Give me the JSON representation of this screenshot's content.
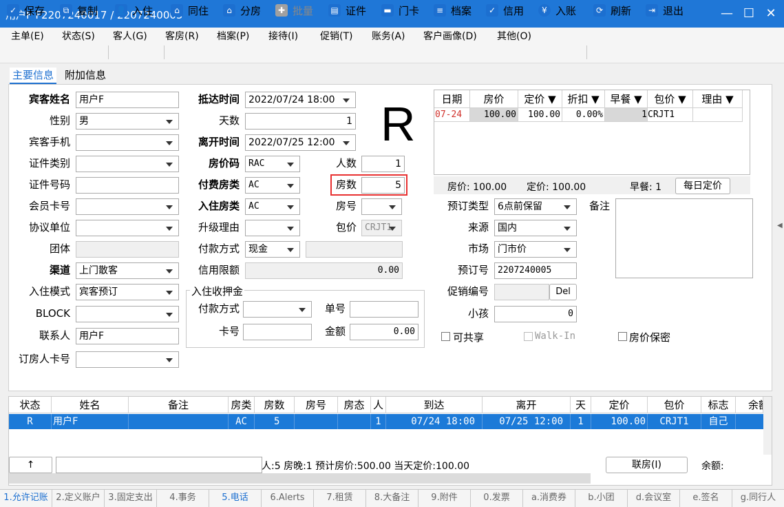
{
  "window": {
    "title": "用户F  F2207240017 / 2207240005",
    "min": "—",
    "max": "☐",
    "close": "✕"
  },
  "menu": [
    "主单(E)",
    "状态(S)",
    "客人(G)",
    "客房(R)",
    "档案(P)",
    "接待(I)",
    "促销(T)",
    "账务(A)",
    "客户画像(D)",
    "其他(O)"
  ],
  "toolbar": [
    {
      "label": "保存",
      "icon": "save-icon",
      "glyph": "✓"
    },
    {
      "label": "复制",
      "icon": "copy-icon",
      "glyph": "⧉"
    },
    {
      "label": "入住",
      "icon": "checkin-icon",
      "glyph": "👤"
    },
    {
      "label": "同住",
      "icon": "share-room-icon",
      "glyph": "⌂"
    },
    {
      "label": "分房",
      "icon": "assign-room-icon",
      "glyph": "⌂"
    },
    {
      "label": "批量",
      "icon": "batch-icon",
      "glyph": "✚"
    },
    {
      "label": "证件",
      "icon": "id-card-icon",
      "glyph": "▤"
    },
    {
      "label": "门卡",
      "icon": "door-card-icon",
      "glyph": "▬"
    },
    {
      "label": "档案",
      "icon": "profile-icon",
      "glyph": "≡"
    },
    {
      "label": "信用",
      "icon": "credit-icon",
      "glyph": "✓"
    },
    {
      "label": "入账",
      "icon": "post-charge-icon",
      "glyph": "¥"
    },
    {
      "label": "刷新",
      "icon": "refresh-icon",
      "glyph": "⟳"
    },
    {
      "label": "退出",
      "icon": "exit-icon",
      "glyph": "⇥"
    }
  ],
  "tabs": {
    "main": "主要信息",
    "extra": "附加信息"
  },
  "form": {
    "guest_name_label": "宾客姓名",
    "guest_name": "用户F",
    "gender_label": "性别",
    "gender": "男",
    "mobile_label": "宾客手机",
    "mobile": "",
    "id_type_label": "证件类别",
    "id_type": "",
    "id_no_label": "证件号码",
    "id_no": "",
    "member_label": "会员卡号",
    "member": "",
    "agreement_label": "协议单位",
    "agreement": "",
    "group_label": "团体",
    "group": "",
    "channel_label": "渠道",
    "channel": "上门散客",
    "mode_label": "入住模式",
    "mode": "宾客预订",
    "block_label": "BLOCK",
    "block": "",
    "contact_label": "联系人",
    "contact": "用户F",
    "booker_label": "订房人卡号",
    "booker": "",
    "arrive_label": "抵达时间",
    "arrive": "2022/07/24 18:00",
    "days_label": "天数",
    "days": "1",
    "depart_label": "离开时间",
    "depart": "2022/07/25 12:00",
    "rate_code_label": "房价码",
    "rate_code": "RAC",
    "persons_label": "人数",
    "persons": "1",
    "pay_room_label": "付费房类",
    "pay_room": "AC",
    "rooms_label": "房数",
    "rooms": "5",
    "stay_room_label": "入住房类",
    "stay_room": "AC",
    "room_no_label": "房号",
    "room_no": "",
    "upgrade_label": "升级理由",
    "upgrade": "",
    "package_label": "包价",
    "package": "CRJT1",
    "pay_method_label": "付款方式",
    "pay_method": "现金",
    "credit_label": "信用限额",
    "credit": "0.00",
    "deposit_title": "入住收押金",
    "dep_pay_label": "付款方式",
    "dep_pay": "",
    "dep_no_label": "单号",
    "dep_no": "",
    "dep_card_label": "卡号",
    "dep_card": "",
    "dep_amount_label": "金额",
    "dep_amount": "0.00",
    "status_letter": "R",
    "book_type_label": "预订类型",
    "book_type": "6点前保留",
    "source_label": "来源",
    "source": "国内",
    "market_label": "市场",
    "market": "门市价",
    "book_no_label": "预订号",
    "book_no": "2207240005",
    "promo_label": "促销编号",
    "promo": "",
    "del": "Del",
    "child_label": "小孩",
    "child": "0",
    "remark_label": "备注",
    "sharable": "可共享",
    "walkin": "Walk-In",
    "rate_secret": "房价保密"
  },
  "rate_grid": {
    "headers": [
      "日期",
      "房价",
      "定价 ▼",
      "折扣 ▼",
      "早餐 ▼",
      "包价 ▼",
      "理由 ▼"
    ],
    "row": [
      "07-24",
      "100.00",
      "100.00",
      "0.00%",
      "1",
      "CRJT1",
      ""
    ],
    "summary_rate": "房价: 100.00",
    "summary_fixed": "定价: 100.00",
    "summary_bf": "早餐: 1",
    "daily_btn": "每日定价"
  },
  "list": {
    "headers": [
      "状态",
      "姓名",
      "备注",
      "房类",
      "房数",
      "房号",
      "房态",
      "人",
      "到达",
      "离开",
      "天",
      "定价",
      "包价",
      "标志",
      "余额"
    ],
    "row": [
      "R",
      "用户F",
      "",
      "AC",
      "5",
      "",
      "",
      "1",
      "07/24 18:00",
      "07/25 12:00",
      "1",
      "100.00",
      "CRJT1",
      "自己",
      ""
    ],
    "up_btn": "↑",
    "summary": "人:5  房晚:1  预计房价:500.00  当天定价:100.00",
    "link_btn": "联房(I)",
    "balance": "余额:"
  },
  "status_tabs": [
    "1.允许记账",
    "2.定义账户",
    "3.固定支出",
    "4.事务",
    "5.电话",
    "6.Alerts",
    "7.租赁",
    "8.大备注",
    "9.附件",
    "0.发票",
    "a.消费券",
    "b.小团",
    "d.会议室",
    "e.签名",
    "g.同行人"
  ]
}
